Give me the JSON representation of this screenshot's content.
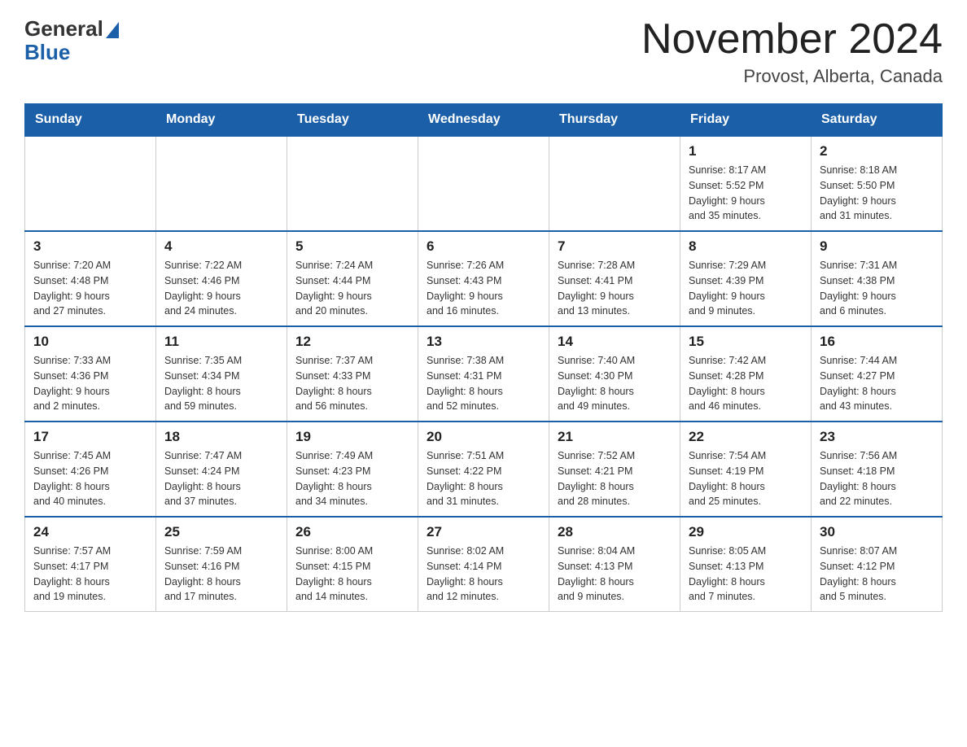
{
  "header": {
    "logo_general": "General",
    "logo_blue": "Blue",
    "title": "November 2024",
    "subtitle": "Provost, Alberta, Canada"
  },
  "days_of_week": [
    "Sunday",
    "Monday",
    "Tuesday",
    "Wednesday",
    "Thursday",
    "Friday",
    "Saturday"
  ],
  "weeks": [
    {
      "cells": [
        {
          "day": "",
          "info": ""
        },
        {
          "day": "",
          "info": ""
        },
        {
          "day": "",
          "info": ""
        },
        {
          "day": "",
          "info": ""
        },
        {
          "day": "",
          "info": ""
        },
        {
          "day": "1",
          "info": "Sunrise: 8:17 AM\nSunset: 5:52 PM\nDaylight: 9 hours\nand 35 minutes."
        },
        {
          "day": "2",
          "info": "Sunrise: 8:18 AM\nSunset: 5:50 PM\nDaylight: 9 hours\nand 31 minutes."
        }
      ]
    },
    {
      "cells": [
        {
          "day": "3",
          "info": "Sunrise: 7:20 AM\nSunset: 4:48 PM\nDaylight: 9 hours\nand 27 minutes."
        },
        {
          "day": "4",
          "info": "Sunrise: 7:22 AM\nSunset: 4:46 PM\nDaylight: 9 hours\nand 24 minutes."
        },
        {
          "day": "5",
          "info": "Sunrise: 7:24 AM\nSunset: 4:44 PM\nDaylight: 9 hours\nand 20 minutes."
        },
        {
          "day": "6",
          "info": "Sunrise: 7:26 AM\nSunset: 4:43 PM\nDaylight: 9 hours\nand 16 minutes."
        },
        {
          "day": "7",
          "info": "Sunrise: 7:28 AM\nSunset: 4:41 PM\nDaylight: 9 hours\nand 13 minutes."
        },
        {
          "day": "8",
          "info": "Sunrise: 7:29 AM\nSunset: 4:39 PM\nDaylight: 9 hours\nand 9 minutes."
        },
        {
          "day": "9",
          "info": "Sunrise: 7:31 AM\nSunset: 4:38 PM\nDaylight: 9 hours\nand 6 minutes."
        }
      ]
    },
    {
      "cells": [
        {
          "day": "10",
          "info": "Sunrise: 7:33 AM\nSunset: 4:36 PM\nDaylight: 9 hours\nand 2 minutes."
        },
        {
          "day": "11",
          "info": "Sunrise: 7:35 AM\nSunset: 4:34 PM\nDaylight: 8 hours\nand 59 minutes."
        },
        {
          "day": "12",
          "info": "Sunrise: 7:37 AM\nSunset: 4:33 PM\nDaylight: 8 hours\nand 56 minutes."
        },
        {
          "day": "13",
          "info": "Sunrise: 7:38 AM\nSunset: 4:31 PM\nDaylight: 8 hours\nand 52 minutes."
        },
        {
          "day": "14",
          "info": "Sunrise: 7:40 AM\nSunset: 4:30 PM\nDaylight: 8 hours\nand 49 minutes."
        },
        {
          "day": "15",
          "info": "Sunrise: 7:42 AM\nSunset: 4:28 PM\nDaylight: 8 hours\nand 46 minutes."
        },
        {
          "day": "16",
          "info": "Sunrise: 7:44 AM\nSunset: 4:27 PM\nDaylight: 8 hours\nand 43 minutes."
        }
      ]
    },
    {
      "cells": [
        {
          "day": "17",
          "info": "Sunrise: 7:45 AM\nSunset: 4:26 PM\nDaylight: 8 hours\nand 40 minutes."
        },
        {
          "day": "18",
          "info": "Sunrise: 7:47 AM\nSunset: 4:24 PM\nDaylight: 8 hours\nand 37 minutes."
        },
        {
          "day": "19",
          "info": "Sunrise: 7:49 AM\nSunset: 4:23 PM\nDaylight: 8 hours\nand 34 minutes."
        },
        {
          "day": "20",
          "info": "Sunrise: 7:51 AM\nSunset: 4:22 PM\nDaylight: 8 hours\nand 31 minutes."
        },
        {
          "day": "21",
          "info": "Sunrise: 7:52 AM\nSunset: 4:21 PM\nDaylight: 8 hours\nand 28 minutes."
        },
        {
          "day": "22",
          "info": "Sunrise: 7:54 AM\nSunset: 4:19 PM\nDaylight: 8 hours\nand 25 minutes."
        },
        {
          "day": "23",
          "info": "Sunrise: 7:56 AM\nSunset: 4:18 PM\nDaylight: 8 hours\nand 22 minutes."
        }
      ]
    },
    {
      "cells": [
        {
          "day": "24",
          "info": "Sunrise: 7:57 AM\nSunset: 4:17 PM\nDaylight: 8 hours\nand 19 minutes."
        },
        {
          "day": "25",
          "info": "Sunrise: 7:59 AM\nSunset: 4:16 PM\nDaylight: 8 hours\nand 17 minutes."
        },
        {
          "day": "26",
          "info": "Sunrise: 8:00 AM\nSunset: 4:15 PM\nDaylight: 8 hours\nand 14 minutes."
        },
        {
          "day": "27",
          "info": "Sunrise: 8:02 AM\nSunset: 4:14 PM\nDaylight: 8 hours\nand 12 minutes."
        },
        {
          "day": "28",
          "info": "Sunrise: 8:04 AM\nSunset: 4:13 PM\nDaylight: 8 hours\nand 9 minutes."
        },
        {
          "day": "29",
          "info": "Sunrise: 8:05 AM\nSunset: 4:13 PM\nDaylight: 8 hours\nand 7 minutes."
        },
        {
          "day": "30",
          "info": "Sunrise: 8:07 AM\nSunset: 4:12 PM\nDaylight: 8 hours\nand 5 minutes."
        }
      ]
    }
  ]
}
